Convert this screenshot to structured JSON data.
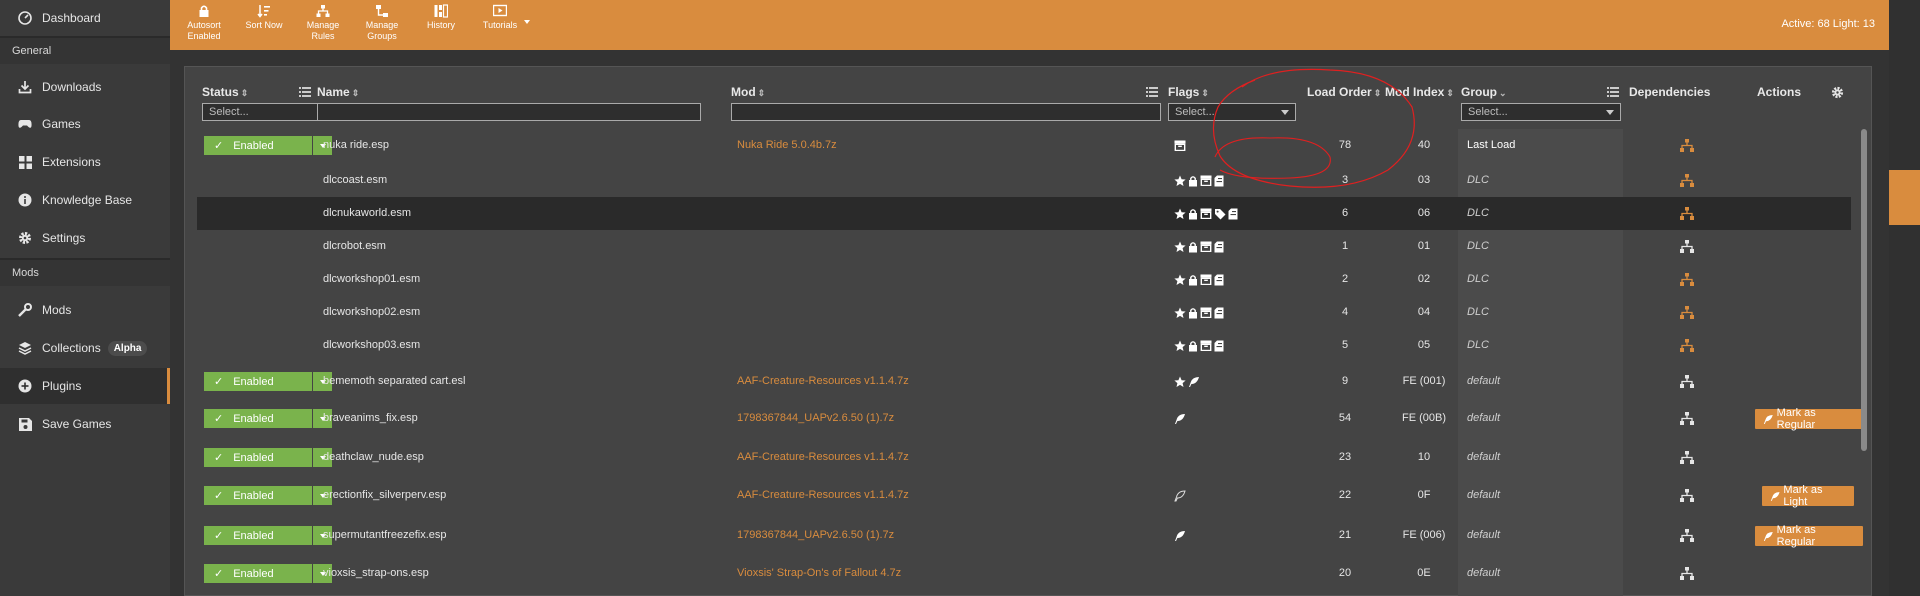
{
  "sidebar": {
    "top_item": {
      "label": "Dashboard",
      "icon": "dashboard-icon"
    },
    "sections": [
      {
        "title": "General",
        "items": [
          {
            "label": "Downloads",
            "icon": "download-icon"
          },
          {
            "label": "Games",
            "icon": "gamepad-icon"
          },
          {
            "label": "Extensions",
            "icon": "extensions-icon"
          },
          {
            "label": "Knowledge Base",
            "icon": "info-icon"
          },
          {
            "label": "Settings",
            "icon": "gear-icon"
          }
        ]
      },
      {
        "title": "Mods",
        "items": [
          {
            "label": "Mods",
            "icon": "wrench-icon"
          },
          {
            "label": "Collections",
            "icon": "layers-icon",
            "badge": "Alpha"
          },
          {
            "label": "Plugins",
            "icon": "plus-circle-icon",
            "active": true
          },
          {
            "label": "Save Games",
            "icon": "save-icon"
          }
        ]
      }
    ]
  },
  "toolbar": {
    "buttons": [
      {
        "label": "Autosort\nEnabled",
        "icon": "lock-icon"
      },
      {
        "label": "Sort Now",
        "icon": "sort-icon"
      },
      {
        "label": "Manage\nRules",
        "icon": "rules-icon"
      },
      {
        "label": "Manage\nGroups",
        "icon": "groups-icon"
      },
      {
        "label": "History",
        "icon": "history-icon"
      },
      {
        "label": "Tutorials",
        "icon": "video-icon"
      }
    ],
    "active_light": "Active: 68 Light: 13"
  },
  "table": {
    "columns": {
      "status": "Status",
      "name": "Name",
      "mod": "Mod",
      "flags": "Flags",
      "load_order": "Load Order",
      "mod_index": "Mod Index",
      "group": "Group",
      "dependencies": "Dependencies",
      "actions": "Actions"
    },
    "filters": {
      "status_placeholder": "Select...",
      "flags_placeholder": "Select...",
      "group_placeholder": "Select..."
    },
    "rows": [
      {
        "status": "Enabled",
        "name": "nuka ride.esp",
        "mod": "Nuka Ride 5.0.4b.7z",
        "flags": [
          "archive"
        ],
        "load_order": "78",
        "mod_index": "40",
        "group": "Last Load",
        "group_italic": false,
        "dep_orange": true,
        "action": ""
      },
      {
        "status": "",
        "name": "dlccoast.esm",
        "mod": "",
        "flags": [
          "star",
          "lock",
          "archive",
          "doc"
        ],
        "load_order": "3",
        "mod_index": "03",
        "group": "DLC",
        "group_italic": true,
        "dep_orange": true,
        "action": ""
      },
      {
        "status": "",
        "name": "dlcnukaworld.esm",
        "mod": "",
        "flags": [
          "star",
          "lock",
          "archive",
          "tag",
          "doc"
        ],
        "load_order": "6",
        "mod_index": "06",
        "group": "DLC",
        "group_italic": true,
        "dep_orange": true,
        "action": "",
        "highlight": true
      },
      {
        "status": "",
        "name": "dlcrobot.esm",
        "mod": "",
        "flags": [
          "star",
          "lock",
          "archive",
          "doc"
        ],
        "load_order": "1",
        "mod_index": "01",
        "group": "DLC",
        "group_italic": true,
        "dep_orange": false,
        "action": ""
      },
      {
        "status": "",
        "name": "dlcworkshop01.esm",
        "mod": "",
        "flags": [
          "star",
          "lock",
          "archive",
          "doc"
        ],
        "load_order": "2",
        "mod_index": "02",
        "group": "DLC",
        "group_italic": true,
        "dep_orange": true,
        "action": ""
      },
      {
        "status": "",
        "name": "dlcworkshop02.esm",
        "mod": "",
        "flags": [
          "star",
          "lock",
          "archive",
          "doc"
        ],
        "load_order": "4",
        "mod_index": "04",
        "group": "DLC",
        "group_italic": true,
        "dep_orange": true,
        "action": ""
      },
      {
        "status": "",
        "name": "dlcworkshop03.esm",
        "mod": "",
        "flags": [
          "star",
          "lock",
          "archive",
          "doc"
        ],
        "load_order": "5",
        "mod_index": "05",
        "group": "DLC",
        "group_italic": true,
        "dep_orange": true,
        "action": ""
      },
      {
        "status": "Enabled",
        "name": "bememoth separated cart.esl",
        "mod": "AAF-Creature-Resources v1.1.4.7z",
        "flags": [
          "star",
          "feather"
        ],
        "load_order": "9",
        "mod_index": "FE (001)",
        "group": "default",
        "group_italic": true,
        "dep_orange": false,
        "action": ""
      },
      {
        "status": "Enabled",
        "name": "braveanims_fix.esp",
        "mod": "1798367844_UAPv2.6.50 (1).7z",
        "flags": [
          "feather"
        ],
        "load_order": "54",
        "mod_index": "FE (00B)",
        "group": "default",
        "group_italic": true,
        "dep_orange": false,
        "action": "Mark as Regular"
      },
      {
        "status": "Enabled",
        "name": "deathclaw_nude.esp",
        "mod": "AAF-Creature-Resources v1.1.4.7z",
        "flags": [],
        "load_order": "23",
        "mod_index": "10",
        "group": "default",
        "group_italic": true,
        "dep_orange": false,
        "action": ""
      },
      {
        "status": "Enabled",
        "name": "erectionfix_silverperv.esp",
        "mod": "AAF-Creature-Resources v1.1.4.7z",
        "flags": [
          "feather-outline"
        ],
        "load_order": "22",
        "mod_index": "0F",
        "group": "default",
        "group_italic": true,
        "dep_orange": false,
        "action": "Mark as Light"
      },
      {
        "status": "Enabled",
        "name": "supermutantfreezefix.esp",
        "mod": "1798367844_UAPv2.6.50 (1).7z",
        "flags": [
          "feather"
        ],
        "load_order": "21",
        "mod_index": "FE (006)",
        "group": "default",
        "group_italic": true,
        "dep_orange": false,
        "action": "Mark as Regular"
      },
      {
        "status": "Enabled",
        "name": "vioxsis_strap-ons.esp",
        "mod": "Vioxsis' Strap-On's of Fallout 4.7z",
        "flags": [],
        "load_order": "20",
        "mod_index": "0E",
        "group": "default",
        "group_italic": true,
        "dep_orange": false,
        "action": ""
      }
    ]
  },
  "colors": {
    "accent": "#d98c3e",
    "enabled": "#7ab34c",
    "annotation": "#e02020"
  }
}
